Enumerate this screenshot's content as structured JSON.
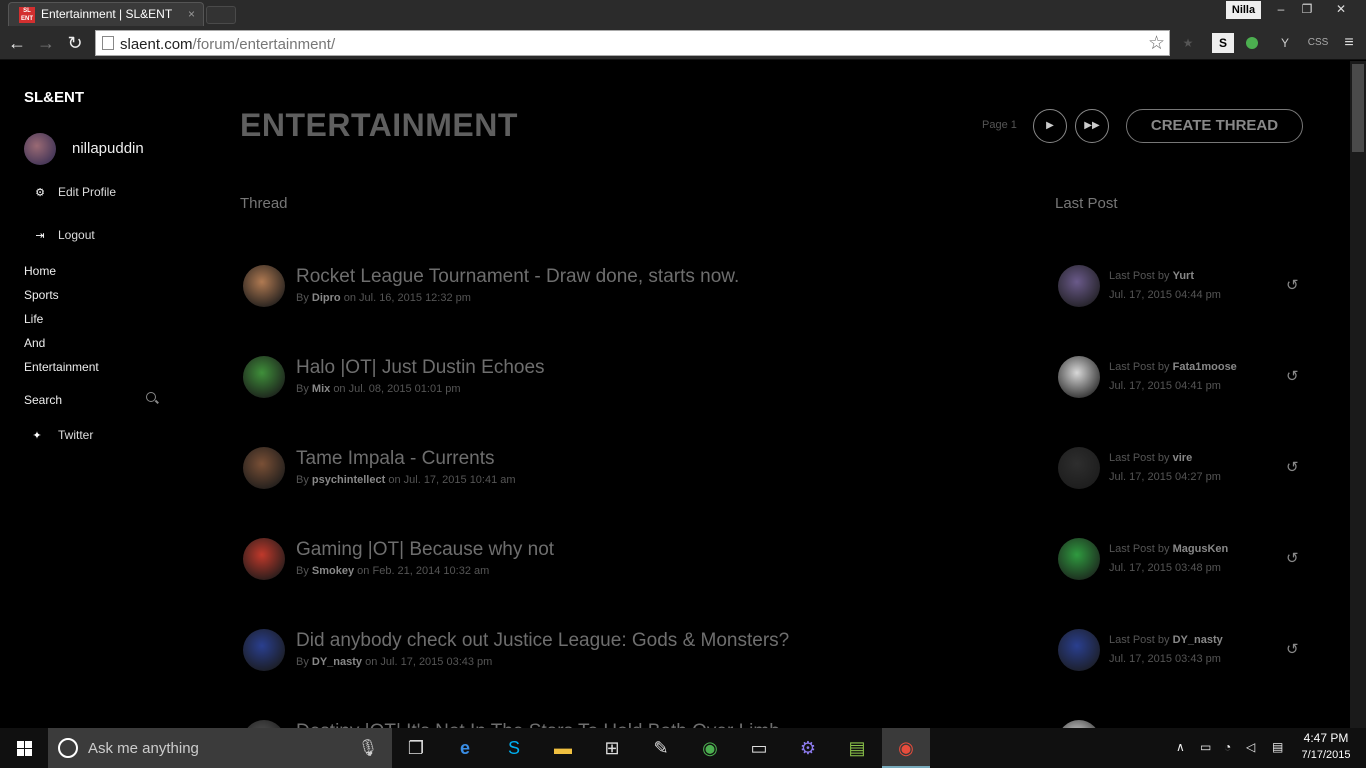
{
  "browser": {
    "tab_title": "Entertainment | SL&ENT",
    "tab_favicon_text": "SL ENT",
    "tab_close": "×",
    "profile_name": "Nilla",
    "url_host": "slaent.com",
    "url_path": "/forum/entertainment/",
    "ext_css_label": "CSS"
  },
  "sidebar": {
    "brand": "SL&ENT",
    "username": "nillapuddin",
    "edit_profile": "Edit Profile",
    "logout": "Logout",
    "nav": [
      "Home",
      "Sports",
      "Life",
      "And",
      "Entertainment"
    ],
    "search": "Search",
    "twitter": "Twitter"
  },
  "main": {
    "title": "ENTERTAINMENT",
    "page_label": "Page 1",
    "create_thread": "CREATE THREAD",
    "col_thread": "Thread",
    "col_last_post": "Last Post",
    "last_post_prefix": "Last Post by",
    "by_prefix": "By",
    "on_word": "on"
  },
  "threads": [
    {
      "title": "Rocket League Tournament - Draw done, starts now.",
      "author": "Dipro",
      "date": "Jul. 16, 2015 12:32 pm",
      "last_user": "Yurt",
      "last_date": "Jul. 17, 2015 04:44 pm",
      "avatar_color": "#b07a52",
      "last_avatar_color": "#6a5a8a"
    },
    {
      "title": "Halo |OT| Just Dustin Echoes",
      "author": "Mix",
      "date": "Jul. 08, 2015 01:01 pm",
      "last_user": "Fata1moose",
      "last_date": "Jul. 17, 2015 04:41 pm",
      "avatar_color": "#3f8f3a",
      "last_avatar_color": "#d8d8d8"
    },
    {
      "title": "Tame Impala - Currents",
      "author": "psychintellect",
      "date": "Jul. 17, 2015 10:41 am",
      "last_user": "vire",
      "last_date": "Jul. 17, 2015 04:27 pm",
      "avatar_color": "#7a5036",
      "last_avatar_color": "#2e2e2e"
    },
    {
      "title": "Gaming |OT| Because why not",
      "author": "Smokey",
      "date": "Feb. 21, 2014 10:32 am",
      "last_user": "MagusKen",
      "last_date": "Jul. 17, 2015 03:48 pm",
      "avatar_color": "#c0392b",
      "last_avatar_color": "#2f9a3f"
    },
    {
      "title": "Did anybody check out Justice League: Gods & Monsters?",
      "author": "DY_nasty",
      "date": "Jul. 17, 2015 03:43 pm",
      "last_user": "DY_nasty",
      "last_date": "Jul. 17, 2015 03:43 pm",
      "avatar_color": "#2a3f8f",
      "last_avatar_color": "#2a3f8f"
    },
    {
      "title": "Destiny |OT| It's Not In The Stars To Hold Both Over Limb",
      "author": "",
      "date": "",
      "last_user": "",
      "last_date": "",
      "avatar_color": "#555555",
      "last_avatar_color": "#dddddd"
    }
  ],
  "taskbar": {
    "search_placeholder": "Ask me anything",
    "time": "4:47 PM",
    "date": "7/17/2015"
  },
  "colors": {
    "page_bg": "#000000",
    "title_gray": "#5f5f5f",
    "thread_gray": "#6e6e6e",
    "chrome_bg": "#2b2b2b"
  }
}
